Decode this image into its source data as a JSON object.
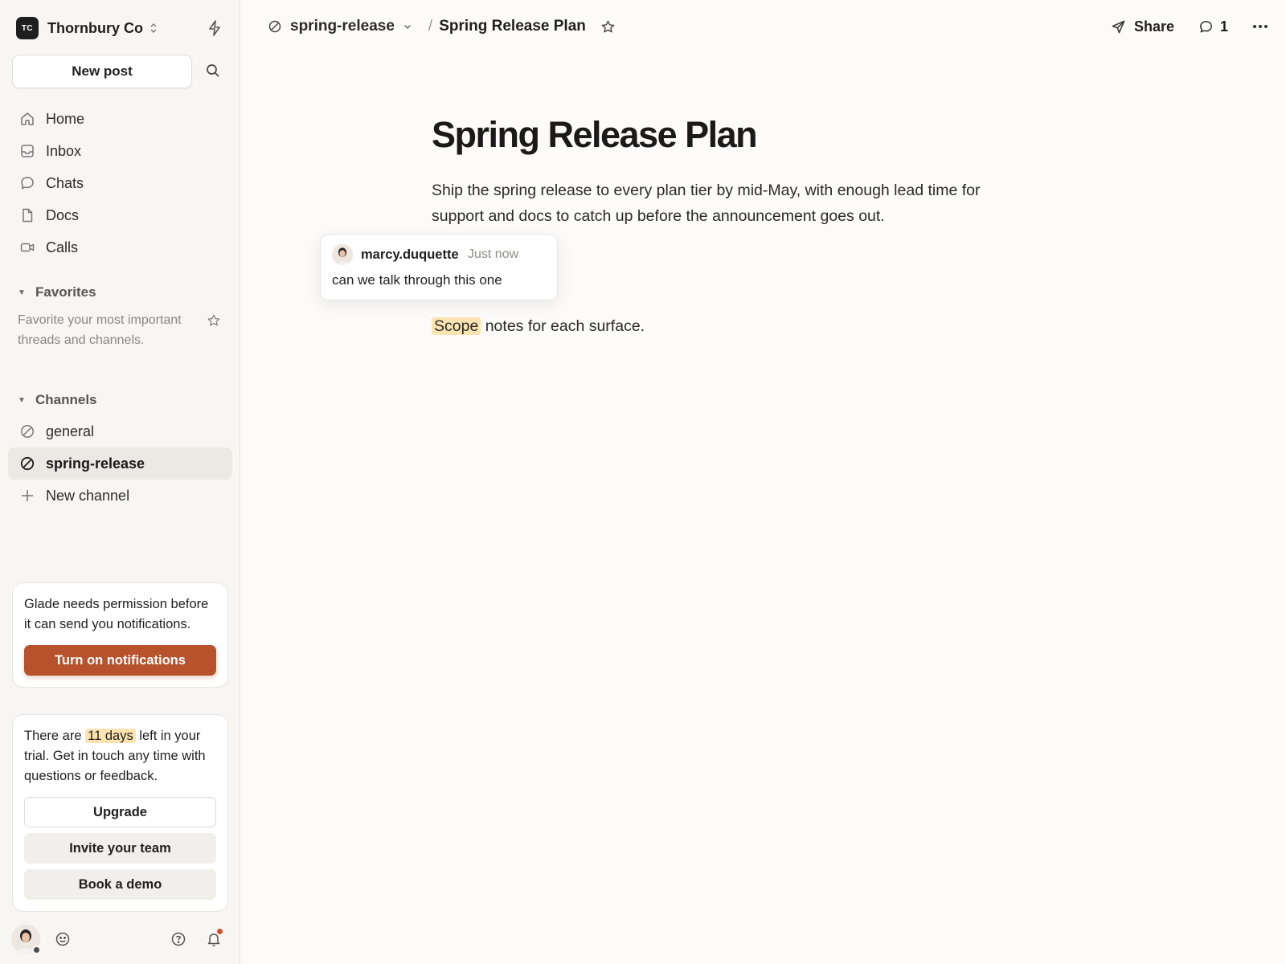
{
  "workspace": {
    "initials": "TC",
    "name": "Thornbury Co"
  },
  "sidebar": {
    "new_post": "New post",
    "nav": [
      {
        "label": "Home",
        "icon": "home-icon"
      },
      {
        "label": "Inbox",
        "icon": "inbox-icon"
      },
      {
        "label": "Chats",
        "icon": "chat-icon"
      },
      {
        "label": "Docs",
        "icon": "doc-icon"
      },
      {
        "label": "Calls",
        "icon": "video-icon"
      }
    ],
    "favorites": {
      "title": "Favorites",
      "hint": "Favorite your most important threads and channels."
    },
    "channels": {
      "title": "Channels",
      "items": [
        {
          "label": "general",
          "active": false
        },
        {
          "label": "spring-release",
          "active": true
        }
      ],
      "new_channel": "New channel"
    },
    "notify_card": {
      "text": "Glade needs permission before it can send you notifications.",
      "button": "Turn on notifications"
    },
    "trial_card": {
      "text_before": "There are ",
      "highlight": "11 days",
      "text_after": " left in your trial. Get in touch any time with questions or feedback.",
      "upgrade": "Upgrade",
      "invite": "Invite your team",
      "demo": "Book a demo"
    }
  },
  "topbar": {
    "channel": "spring-release",
    "separator": "/",
    "page": "Spring Release Plan",
    "share": "Share",
    "comment_count": "1"
  },
  "doc": {
    "title": "Spring Release Plan",
    "paragraph": "Ship the spring release to every plan tier by mid-May, with enough lead time for support and docs to catch up before the announcement goes out.",
    "scope_word": "Scope",
    "scope_rest": " notes for each surface."
  },
  "comment": {
    "user": "marcy.duquette",
    "time": "Just now",
    "text": "can we talk through this one"
  },
  "colors": {
    "accent": "#b7522d",
    "highlight": "#fbe4b0",
    "notification_dot": "#d2512b"
  }
}
